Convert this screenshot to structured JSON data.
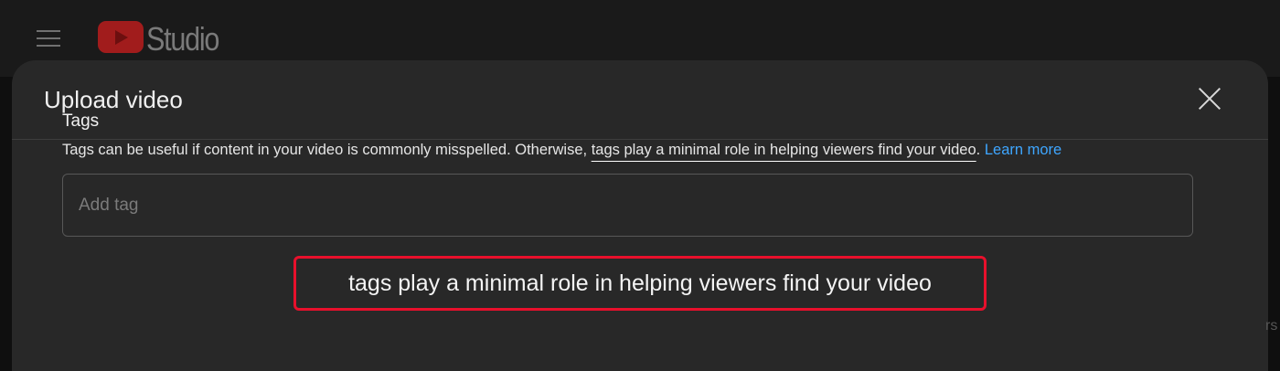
{
  "app": {
    "logo_text": "Studio"
  },
  "dialog": {
    "title": "Upload video",
    "close_label": "close"
  },
  "tags": {
    "title": "Tags",
    "description_start": "Tags can be useful if content in your video is commonly misspelled. Otherwise, ",
    "description_underlined": "tags play a minimal role in helping viewers find your video",
    "description_end": ".",
    "learn_more": "Learn more",
    "input_placeholder": "Add tag",
    "input_value": ""
  },
  "highlight": {
    "text": "tags play a minimal role in helping viewers find your video",
    "border_color": "#e8102c"
  },
  "colors": {
    "accent_link": "#3ea6ff",
    "brand_red": "#a11c1c"
  },
  "edge_text": "rs"
}
